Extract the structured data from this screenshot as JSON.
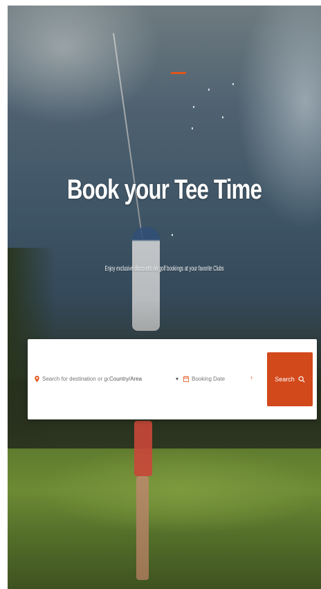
{
  "hero": {
    "title": "Book your Tee Time",
    "subtitle": "Enjoy exclusive discounts on golf bookings at your favorite Clubs"
  },
  "search": {
    "destination_placeholder": "Search for destination or golf course",
    "country_select": "Country/Area",
    "date_placeholder": "Booking Date",
    "button_label": "Search"
  },
  "colors": {
    "accent": "#d2491c",
    "card": "#ffffff",
    "title_text": "#ffffff"
  },
  "icons": {
    "destination": "map-pin-icon",
    "country_chevron": "chevron-down-icon",
    "date": "calendar-icon",
    "date_arrow": "chevron-right-icon",
    "search": "search-icon"
  }
}
